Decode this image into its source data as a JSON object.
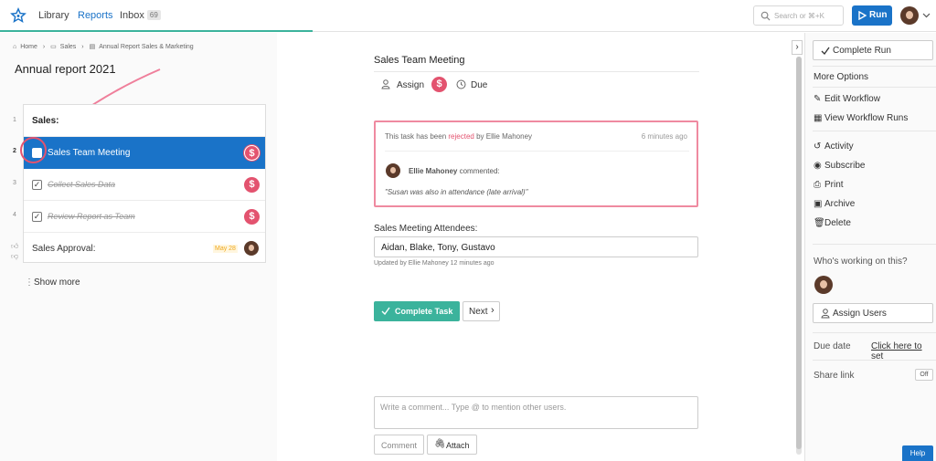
{
  "topbar": {
    "nav": [
      {
        "label": "Library"
      },
      {
        "label": "Reports"
      },
      {
        "label": "Inbox",
        "badge": "69"
      }
    ],
    "search_placeholder": "Search or ⌘+K",
    "run_label": "Run"
  },
  "breadcrumb": [
    "Home",
    "Sales",
    "Annual Report Sales & Marketing"
  ],
  "document_title": "Annual report 2021",
  "tasks": [
    {
      "num": "1",
      "label": "Sales:"
    },
    {
      "num": "2",
      "label": "Sales Team Meeting"
    },
    {
      "num": "3",
      "label": "Collect Sales Data"
    },
    {
      "num": "4",
      "label": "Review Report as Team"
    },
    {
      "label": "Sales Approval:",
      "due": "May 28"
    }
  ],
  "show_more": "Show more",
  "task": {
    "title": "Sales Team Meeting",
    "assign_label": "Assign",
    "due_label": "Due",
    "rejection": {
      "prefix": "This task has been",
      "status": "rejected",
      "by": "by Ellie Mahoney",
      "time": "6 minutes ago",
      "commenter": "Ellie Mahoney",
      "commented_label": "commented:",
      "comment": "\"Susan was also in attendance (late arrival)\""
    },
    "field_label": "Sales Meeting Attendees:",
    "field_value": "Aidan, Blake, Tony, Gustavo",
    "field_updated": "Updated by Ellie Mahoney 12 minutes ago",
    "complete_label": "Complete Task",
    "next_label": "Next",
    "comment_placeholder": "Write a comment... Type @ to mention other users.",
    "comment_button": "Comment",
    "attach_button": "Attach"
  },
  "sidebar": {
    "complete_run": "Complete Run",
    "more_options": "More Options",
    "options": [
      "Edit Workflow",
      "View Workflow Runs",
      "Activity",
      "Subscribe",
      "Print",
      "Archive",
      "Delete"
    ],
    "working_label": "Who's working on this?",
    "assign_users": "Assign Users",
    "due_date_label": "Due date",
    "due_date_link": "Click here to set",
    "share_link_label": "Share link",
    "share_toggle": "Off",
    "help": "Help"
  },
  "colors": {
    "accent": "#1a73c8",
    "success": "#3bb39c",
    "danger": "#e3536f"
  }
}
